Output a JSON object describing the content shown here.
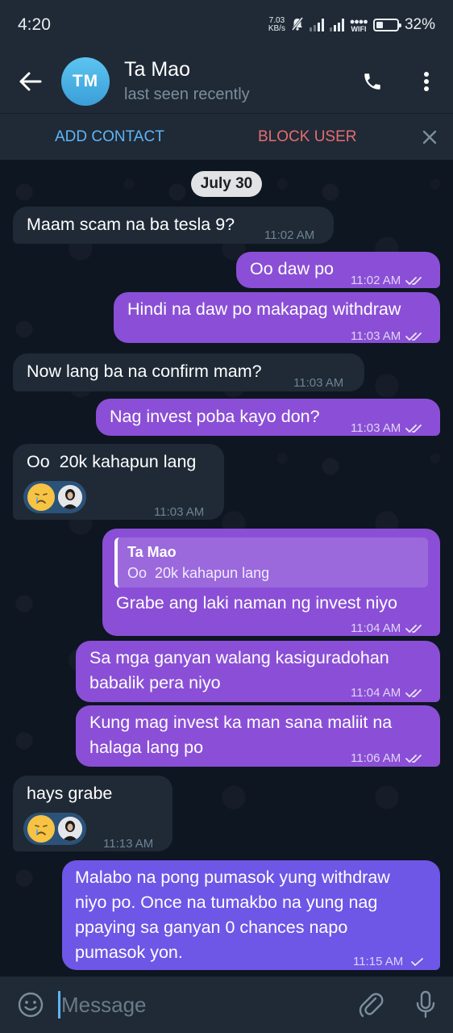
{
  "status_bar": {
    "time": "4:20",
    "net_speed_value": "7.03",
    "net_speed_unit": "KB/s",
    "wifi_label": "WIFI",
    "battery_percent": "32%",
    "battery_level": 0.32
  },
  "header": {
    "avatar_initials": "TM",
    "avatar_color": "#4fb3e8",
    "contact_name": "Ta Mao",
    "contact_status": "last seen recently"
  },
  "action_bar": {
    "add_contact": "ADD CONTACT",
    "block_user": "BLOCK USER"
  },
  "chat": {
    "date": "July 30",
    "messages": [
      {
        "direction": "in",
        "text": "Maam scam na ba tesla 9?",
        "time": "11:02 AM"
      },
      {
        "direction": "out",
        "text": "Oo daw po",
        "time": "11:02 AM",
        "status": "read"
      },
      {
        "direction": "out",
        "text": "Hindi na daw po makapag withdraw",
        "time": "11:03 AM",
        "status": "read"
      },
      {
        "direction": "in",
        "text": "Now lang ba na confirm mam?",
        "time": "11:03 AM"
      },
      {
        "direction": "out",
        "text": "Nag invest poba kayo don?",
        "time": "11:03 AM",
        "status": "read"
      },
      {
        "direction": "in",
        "text": "Oo  20k kahapun lang",
        "time": "11:03 AM",
        "reaction": "crying-face"
      },
      {
        "direction": "out",
        "reply_to_name": "Ta Mao",
        "reply_to_text": "Oo  20k kahapun lang",
        "text": "Grabe ang laki naman ng invest niyo",
        "time": "11:04 AM",
        "status": "read"
      },
      {
        "direction": "out",
        "lines": [
          "Sa mga ganyan walang kasiguradohan",
          "babalik pera niyo"
        ],
        "time": "11:04 AM",
        "status": "read"
      },
      {
        "direction": "out",
        "lines": [
          "Kung mag invest ka man sana maliit na",
          "halaga lang po"
        ],
        "time": "11:06 AM",
        "status": "read"
      },
      {
        "direction": "in",
        "text": "hays grabe",
        "time": "11:13 AM",
        "reaction": "crying-face"
      },
      {
        "direction": "out",
        "lines": [
          "Malabo na pong pumasok yung withdraw",
          "niyo po. Once na tumakbo na yung nag",
          "ppaying sa ganyan 0 chances napo",
          "pumasok yon."
        ],
        "time": "11:15 AM",
        "status": "sent"
      }
    ]
  },
  "input": {
    "placeholder": "Message"
  },
  "colors": {
    "outgoing_bubble": "#8a4fd6",
    "incoming_bubble": "#1f2a36",
    "link_blue": "#5eb5f7",
    "block_red": "#e66c70"
  }
}
